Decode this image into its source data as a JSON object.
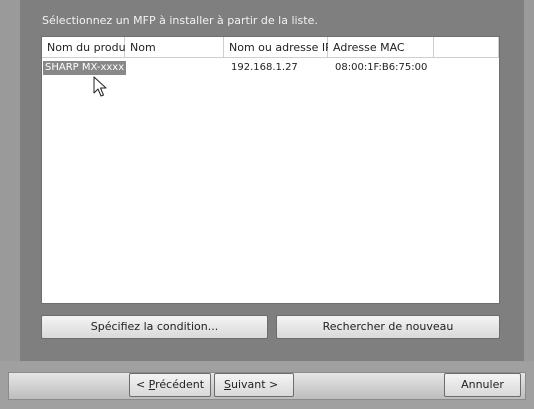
{
  "instruction": "Sélectionnez un MFP à installer à partir de la liste.",
  "table": {
    "columns": [
      "Nom du produit",
      "Nom",
      "Nom ou adresse IP",
      "Adresse MAC"
    ],
    "rows": [
      {
        "product": "SHARP MX-xxxx",
        "name": "",
        "ip": "192.168.1.27",
        "mac": "08:00:1F:B6:75:00"
      }
    ]
  },
  "buttons": {
    "specify": "Spécifiez la condition...",
    "search_again": "Rechercher de nouveau",
    "back_prefix": "< ",
    "back_accel": "P",
    "back_rest": "récédent",
    "next_accel": "S",
    "next_rest": "uivant >",
    "cancel": "Annuler"
  },
  "colors": {
    "dialog_bg": "#7f7f7f",
    "selection": "#888888"
  },
  "icons": {
    "cursor": "mouse-pointer-icon"
  }
}
